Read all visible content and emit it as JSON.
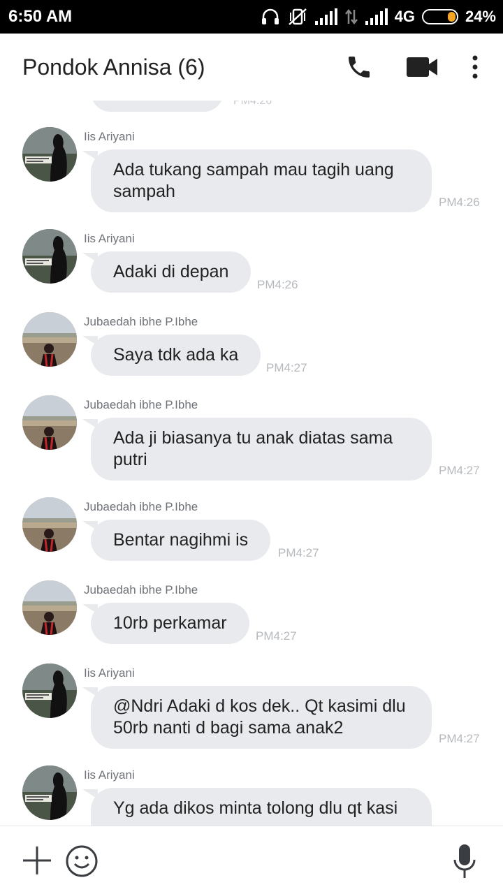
{
  "status_bar": {
    "time": "6:50 AM",
    "network": "4G",
    "battery_percent": "24%",
    "battery_level": 0.24,
    "icons": [
      "headphones-icon",
      "vibrate-off-icon",
      "signal-icon",
      "data-arrows-icon",
      "signal-icon",
      "battery-icon"
    ]
  },
  "header": {
    "title": "Pondok Annisa (6)",
    "icons": [
      "phone-icon",
      "video-call-icon",
      "more-vertical-icon"
    ]
  },
  "partial_top": {
    "time": "PM4:26"
  },
  "messages": [
    {
      "sender": "Iis Ariyani",
      "text": "Ada tukang sampah mau tagih uang sampah",
      "time": "PM4:26",
      "avatar": "silhouette"
    },
    {
      "sender": "Iis Ariyani",
      "text": "Adaki di depan",
      "time": "PM4:26",
      "avatar": "silhouette"
    },
    {
      "sender": "Jubaedah ibhe P.Ibhe",
      "text": "Saya tdk ada ka",
      "time": "PM4:27",
      "avatar": "landscape"
    },
    {
      "sender": "Jubaedah ibhe P.Ibhe",
      "text": "Ada ji biasanya tu anak diatas sama putri",
      "time": "PM4:27",
      "avatar": "landscape"
    },
    {
      "sender": "Jubaedah ibhe P.Ibhe",
      "text": "Bentar nagihmi is",
      "time": "PM4:27",
      "avatar": "landscape"
    },
    {
      "sender": "Jubaedah ibhe P.Ibhe",
      "text": "10rb perkamar",
      "time": "PM4:27",
      "avatar": "landscape"
    },
    {
      "sender": "Iis Ariyani",
      "text": "@Ndri Adaki d kos dek.. Qt kasimi dlu 50rb nanti d bagi sama anak2",
      "time": "PM4:27",
      "avatar": "silhouette"
    },
    {
      "sender": "Iis Ariyani",
      "text": "Yg ada dikos minta tolong dlu qt kasi",
      "time": "",
      "avatar": "silhouette"
    }
  ],
  "input_bar": {
    "icons": [
      "plus-icon",
      "emoji-icon",
      "microphone-icon"
    ]
  },
  "colors": {
    "bubble": "#e8eaed",
    "timestamp": "#b6babe",
    "sender": "#6f7379",
    "title": "#222222",
    "icon": "#222222"
  }
}
